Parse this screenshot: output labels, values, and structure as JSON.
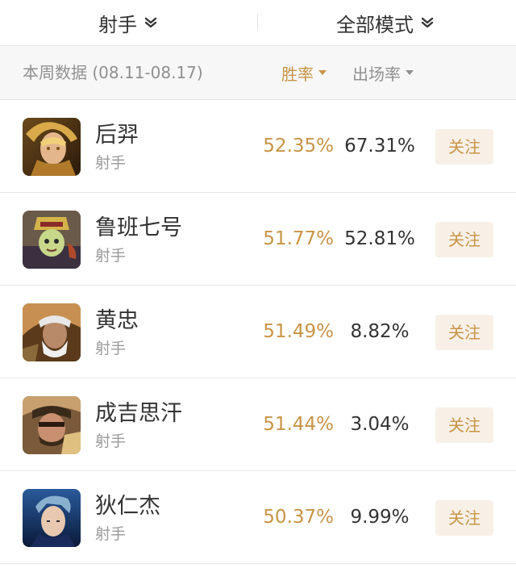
{
  "filters": {
    "role": {
      "label": "射手",
      "icon": "chevron-down-icon"
    },
    "mode": {
      "label": "全部模式",
      "icon": "chevron-down-icon"
    }
  },
  "sort_bar": {
    "period": "本周数据 (08.11-08.17)",
    "win_rate_label": "胜率",
    "pick_rate_label": "出场率",
    "active_sort": "win_rate"
  },
  "heroes": [
    {
      "name": "后羿",
      "role": "射手",
      "win_rate": "52.35%",
      "pick_rate": "67.31%",
      "follow_label": "关注"
    },
    {
      "name": "鲁班七号",
      "role": "射手",
      "win_rate": "51.77%",
      "pick_rate": "52.81%",
      "follow_label": "关注"
    },
    {
      "name": "黄忠",
      "role": "射手",
      "win_rate": "51.49%",
      "pick_rate": "8.82%",
      "follow_label": "关注"
    },
    {
      "name": "成吉思汗",
      "role": "射手",
      "win_rate": "51.44%",
      "pick_rate": "3.04%",
      "follow_label": "关注"
    },
    {
      "name": "狄仁杰",
      "role": "射手",
      "win_rate": "50.37%",
      "pick_rate": "9.99%",
      "follow_label": "关注"
    }
  ],
  "colors": {
    "accent": "#c89447",
    "accent_bg": "#f8f0e7",
    "text": "#333333",
    "muted": "#909090",
    "divider": "#e6e6e6",
    "sort_bar_bg": "#f7f7f7"
  }
}
